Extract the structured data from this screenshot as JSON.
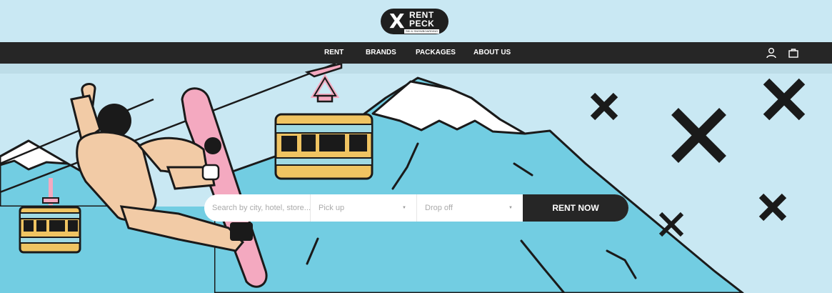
{
  "brand": {
    "logo_mark": "X",
    "name_line1": "RENT",
    "name_line2": "PECK",
    "tagline": "SKI & SNOWBOARDING"
  },
  "nav": {
    "items": [
      {
        "label": "RENT"
      },
      {
        "label": "BRANDS"
      },
      {
        "label": "PACKAGES"
      },
      {
        "label": "ABOUT US"
      }
    ],
    "icons": [
      "user-icon",
      "shopping-bag-icon"
    ]
  },
  "search": {
    "placeholder": "Search by city, hotel, store...",
    "pickup_label": "Pick up",
    "dropoff_label": "Drop off",
    "caret": "▼",
    "submit_label": "RENT NOW"
  },
  "colors": {
    "sky": "#c9e8f3",
    "mountain": "#72cde2",
    "nav_bg": "#262626",
    "cable_car": "#f0c462",
    "snowboard": "#f4a9c0",
    "jacket": "#f2cba6",
    "cable_pink": "#e88aa3",
    "outline": "#1a1a1a"
  }
}
